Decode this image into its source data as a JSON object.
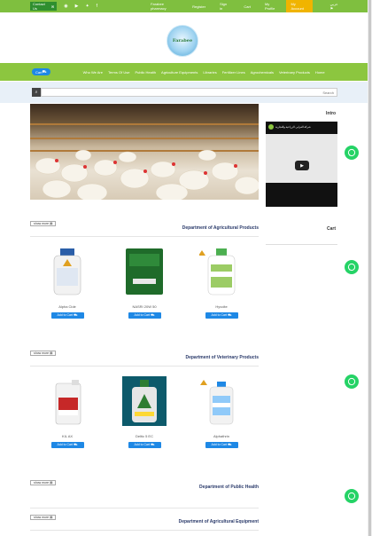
{
  "topbar": {
    "contact_label": "Contact Us",
    "links": [
      "Farabee pharmacy",
      "Register",
      "Sign in",
      "Cart",
      "My Profile",
      "My Account"
    ],
    "language": "عربي"
  },
  "logo": {
    "text": "Farabee"
  },
  "navbar": {
    "cart_label": "Cart",
    "links": [
      "Who We Are",
      "Terms Of Use",
      "Public Health",
      "Agriculture Equipments",
      "Libraries",
      "Fertilizer Lines",
      "Agrochemicals",
      "Veterinary Products",
      "Home"
    ]
  },
  "search": {
    "placeholder": "Search"
  },
  "sidebar": {
    "intro_title": "Intro",
    "video_title": "شركة الفرابي الزراعية والتجارية",
    "cart_title": "Cart"
  },
  "sections": [
    {
      "show_more": "show more",
      "title": "Department of Agricultural Products",
      "products": [
        {
          "name": "Alpha Cide",
          "add_label": "Add to Cart"
        },
        {
          "name": "NASRI 20W 50",
          "add_label": "Add to Cart"
        },
        {
          "name": "Hyvolte",
          "add_label": "Add to Cart"
        }
      ]
    },
    {
      "show_more": "show more",
      "title": "Department of Veterinary Products",
      "products": [
        {
          "name": "KIL AX",
          "add_label": "Add to Cart"
        },
        {
          "name": "Deltic 5 EC",
          "add_label": "Add to Cart"
        },
        {
          "name": "Alphathrin",
          "add_label": "Add to Cart"
        }
      ]
    },
    {
      "show_more": "show more",
      "title": "Department of Public Health"
    },
    {
      "show_more": "show more",
      "title": "Department of Agricultural Equipment"
    }
  ],
  "colors": {
    "topbar": "#7fbf3f",
    "navbar": "#8cc63f",
    "accent_blue": "#1e88e5",
    "my_account": "#f0b400",
    "whatsapp": "#25d366"
  }
}
